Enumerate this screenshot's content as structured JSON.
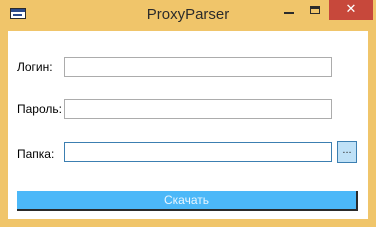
{
  "window": {
    "title": "ProxyParser",
    "close_glyph": "✕",
    "icons": [
      "app-icon",
      "minimize-icon",
      "maximize-icon",
      "close-icon"
    ],
    "accent_color": "#f0c56a",
    "close_color": "#c7483b"
  },
  "form": {
    "login_label": "Логин:",
    "login_value": "",
    "password_label": "Пароль:",
    "password_value": "",
    "folder_label": "Папка:",
    "folder_value": "",
    "browse_label": "...",
    "download_label": "Скачать",
    "button_color": "#4cb8f8"
  }
}
